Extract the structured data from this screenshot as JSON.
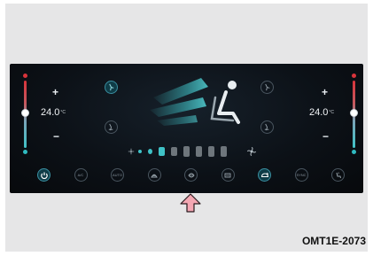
{
  "climate_panel": {
    "left_zone": {
      "plus": "+",
      "minus": "−",
      "temperature": "24.0",
      "unit": "°C"
    },
    "right_zone": {
      "plus": "+",
      "minus": "−",
      "temperature": "24.0",
      "unit": "°C"
    },
    "fan_level": {
      "active": 3,
      "total": 8
    },
    "bottom_buttons": [
      {
        "name": "power-button",
        "label": "",
        "icon": "power-icon",
        "active": true
      },
      {
        "name": "ac-button",
        "label": "A/C",
        "icon": "",
        "active": false
      },
      {
        "name": "auto-button",
        "label": "AUTO",
        "icon": "",
        "active": false
      },
      {
        "name": "front-defrost-button",
        "label": "",
        "icon": "front-defrost-icon",
        "active": false
      },
      {
        "name": "air-purify-button",
        "label": "",
        "icon": "air-purify-icon",
        "active": false
      },
      {
        "name": "rear-defrost-button",
        "label": "",
        "icon": "rear-defrost-icon",
        "active": false
      },
      {
        "name": "recirculation-button",
        "label": "",
        "icon": "recirculation-icon",
        "active": true
      },
      {
        "name": "sync-button",
        "label": "SYNC",
        "icon": "",
        "active": false
      },
      {
        "name": "seat-heat-button",
        "label": "",
        "icon": "seat-heat-icon",
        "active": false
      }
    ],
    "colors": {
      "panel_bg": "#0c1117",
      "accent_teal": "#3fc2c7",
      "hot_red": "#d8343b",
      "arrow_pink": "#f4a7b3"
    }
  },
  "caption": {
    "code": "OMT1E-2073"
  }
}
